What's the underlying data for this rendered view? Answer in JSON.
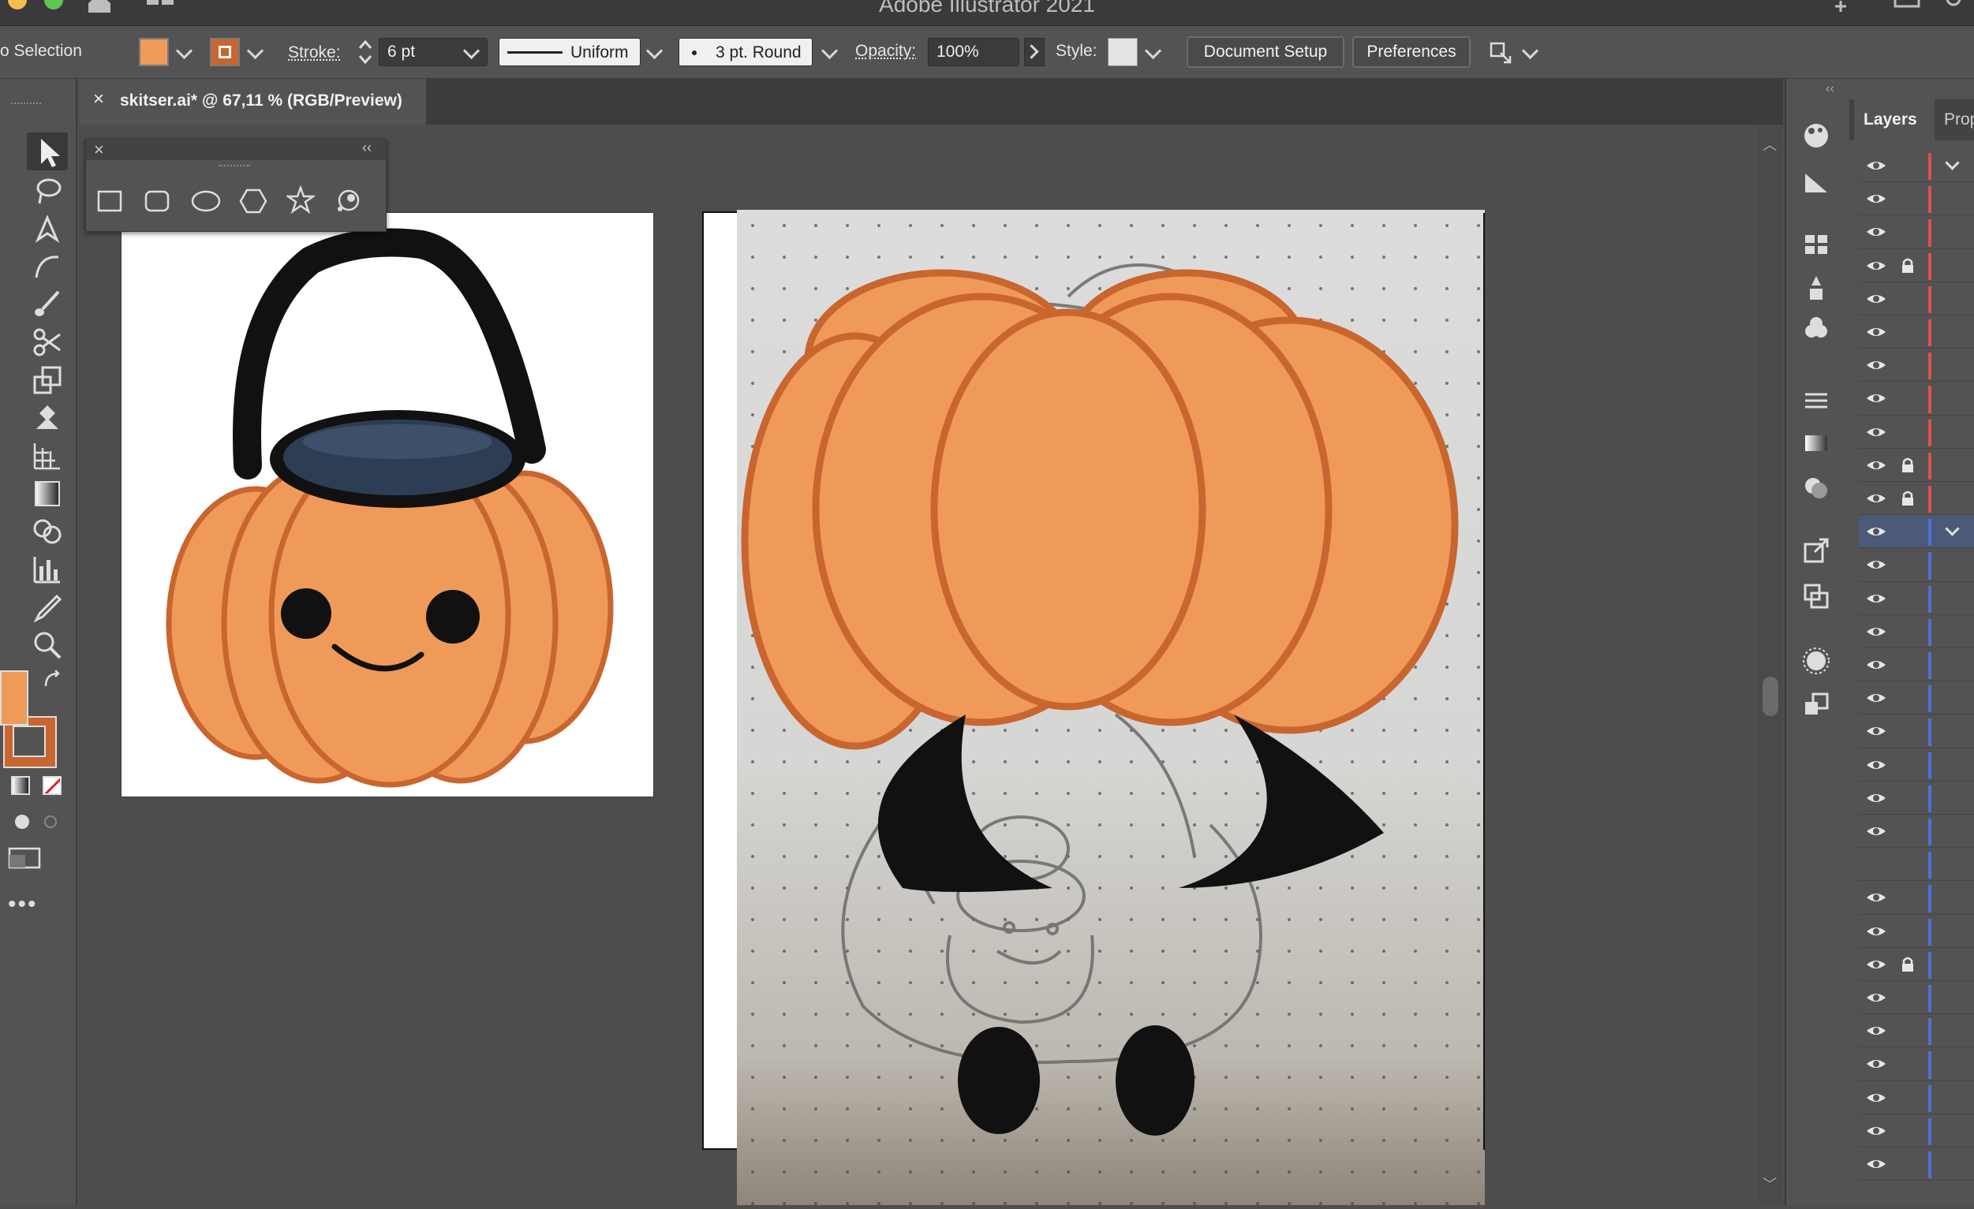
{
  "app": {
    "title": "Adobe Illustrator 2021"
  },
  "control_bar": {
    "selection_label": "o Selection",
    "fill_color": "#ef9a59",
    "stroke_color": "#c9652f",
    "stroke_label": "Stroke:",
    "stroke_weight": "6 pt",
    "stroke_profile": "Uniform",
    "brush": "3 pt. Round",
    "opacity_label": "Opacity:",
    "opacity_value": "100%",
    "style_label": "Style:",
    "document_setup": "Document Setup",
    "preferences": "Preferences"
  },
  "document_tab": {
    "title": "skitser.ai* @ 67,11 % (RGB/Preview)"
  },
  "shapes_panel": {
    "tools": [
      "rectangle-tool-icon",
      "rounded-rectangle-tool-icon",
      "ellipse-tool-icon",
      "polygon-tool-icon",
      "star-tool-icon",
      "flare-tool-icon"
    ]
  },
  "toolbar": {
    "fill_color": "#ef9a59",
    "stroke_color": "#c9652f",
    "tools": [
      "selection-tool-icon",
      "lasso-tool-icon",
      "pen-tool-icon",
      "curvature-tool-icon",
      "paintbrush-tool-icon",
      "scissors-tool-icon",
      "scale-tool-icon",
      "puppet-warp-tool-icon",
      "perspective-grid-tool-icon",
      "gradient-tool-icon",
      "shape-builder-tool-icon",
      "graph-tool-icon",
      "eyedropper-tool-icon",
      "zoom-tool-icon"
    ]
  },
  "panels": {
    "tabs": [
      "Layers",
      "Prop"
    ],
    "accent_red": "#e05050",
    "accent_blue": "#4f6fd8"
  },
  "layers": {
    "rows": [
      {
        "visible": true,
        "locked": false,
        "color": "red",
        "expanded": true
      },
      {
        "visible": true,
        "locked": false,
        "color": "red"
      },
      {
        "visible": true,
        "locked": false,
        "color": "red"
      },
      {
        "visible": true,
        "locked": true,
        "color": "red"
      },
      {
        "visible": true,
        "locked": false,
        "color": "red"
      },
      {
        "visible": true,
        "locked": false,
        "color": "red"
      },
      {
        "visible": true,
        "locked": false,
        "color": "red"
      },
      {
        "visible": true,
        "locked": false,
        "color": "red"
      },
      {
        "visible": true,
        "locked": false,
        "color": "red"
      },
      {
        "visible": true,
        "locked": true,
        "color": "red"
      },
      {
        "visible": true,
        "locked": true,
        "color": "red"
      },
      {
        "visible": true,
        "locked": false,
        "color": "blue",
        "selected": true,
        "expanded": true
      },
      {
        "visible": true,
        "locked": false,
        "color": "blue"
      },
      {
        "visible": true,
        "locked": false,
        "color": "blue"
      },
      {
        "visible": true,
        "locked": false,
        "color": "blue"
      },
      {
        "visible": true,
        "locked": false,
        "color": "blue"
      },
      {
        "visible": true,
        "locked": false,
        "color": "blue"
      },
      {
        "visible": true,
        "locked": false,
        "color": "blue"
      },
      {
        "visible": true,
        "locked": false,
        "color": "blue"
      },
      {
        "visible": true,
        "locked": false,
        "color": "blue"
      },
      {
        "visible": true,
        "locked": false,
        "color": "blue"
      },
      {
        "visible": false,
        "locked": false,
        "color": "blue"
      },
      {
        "visible": true,
        "locked": false,
        "color": "blue"
      },
      {
        "visible": true,
        "locked": false,
        "color": "blue"
      },
      {
        "visible": true,
        "locked": true,
        "color": "blue"
      },
      {
        "visible": true,
        "locked": false,
        "color": "blue"
      },
      {
        "visible": true,
        "locked": false,
        "color": "blue"
      },
      {
        "visible": true,
        "locked": false,
        "color": "blue"
      },
      {
        "visible": true,
        "locked": false,
        "color": "blue"
      },
      {
        "visible": true,
        "locked": false,
        "color": "blue"
      },
      {
        "visible": true,
        "locked": false,
        "color": "blue"
      }
    ]
  },
  "artwork": {
    "pumpkin_fill": "#ef9a59",
    "pumpkin_stroke": "#c9652f",
    "handle": "#111111",
    "rim": "#2d3d54"
  }
}
